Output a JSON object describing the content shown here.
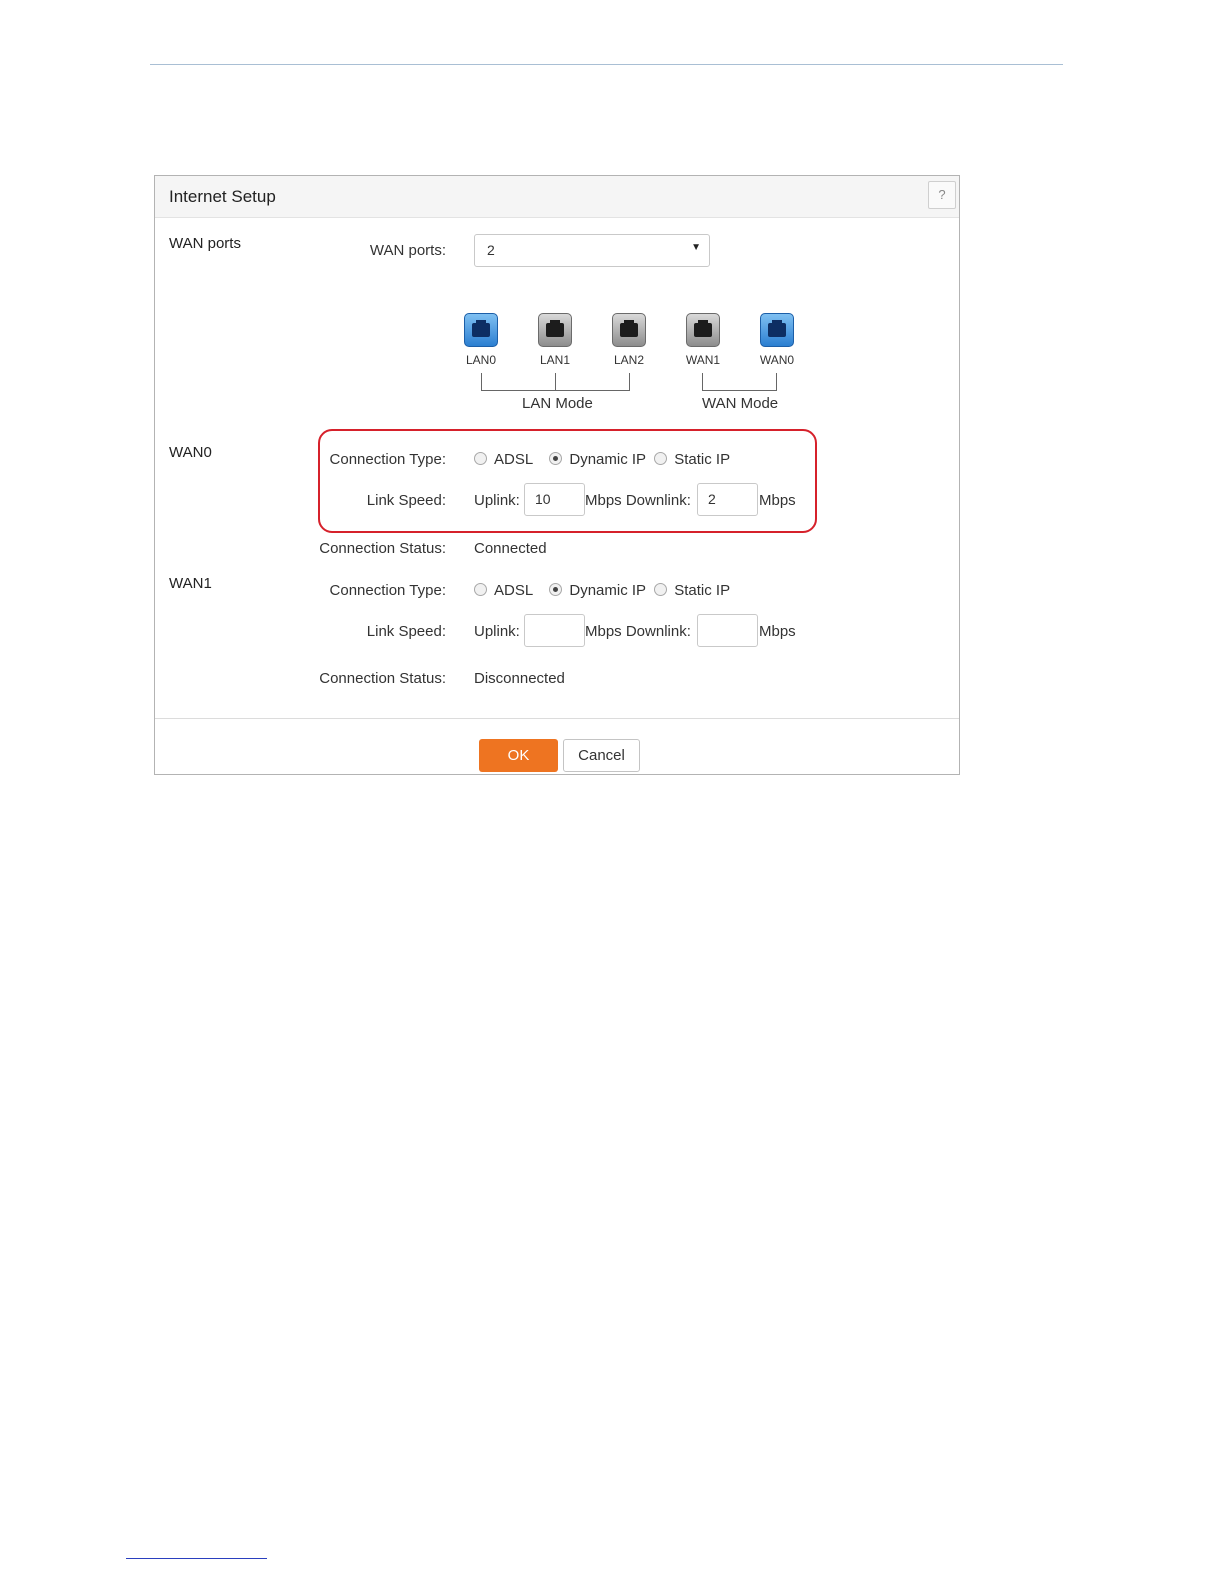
{
  "panel": {
    "title": "Internet Setup",
    "help_label": "?"
  },
  "wan_ports_section": {
    "section_label": "WAN ports",
    "field_label": "WAN ports:",
    "selected_value": "2",
    "caret": "▼"
  },
  "ports": [
    {
      "label": "LAN0",
      "color": "blue",
      "icon": "ethernet-port-icon"
    },
    {
      "label": "LAN1",
      "color": "gray",
      "icon": "ethernet-port-icon"
    },
    {
      "label": "LAN2",
      "color": "gray",
      "icon": "ethernet-port-icon"
    },
    {
      "label": "WAN1",
      "color": "gray",
      "icon": "ethernet-port-icon"
    },
    {
      "label": "WAN0",
      "color": "blue",
      "icon": "ethernet-port-icon"
    }
  ],
  "modes": {
    "lan": "LAN Mode",
    "wan": "WAN Mode"
  },
  "wan0": {
    "section_label": "WAN0",
    "connection_type_label": "Connection Type:",
    "options": [
      "ADSL",
      "Dynamic IP",
      "Static IP"
    ],
    "selected_option": "Dynamic IP",
    "link_speed_label": "Link Speed:",
    "uplink_label": "Uplink:",
    "uplink_value": "10",
    "mbps_downlink_label": "Mbps Downlink:",
    "downlink_value": "2",
    "mbps_label": "Mbps",
    "status_label": "Connection Status:",
    "status_value": "Connected"
  },
  "wan1": {
    "section_label": "WAN1",
    "connection_type_label": "Connection Type:",
    "options": [
      "ADSL",
      "Dynamic IP",
      "Static IP"
    ],
    "selected_option": "Dynamic IP",
    "link_speed_label": "Link Speed:",
    "uplink_label": "Uplink:",
    "uplink_value": "",
    "mbps_downlink_label": "Mbps Downlink:",
    "downlink_value": "",
    "mbps_label": "Mbps",
    "status_label": "Connection Status:",
    "status_value": "Disconnected"
  },
  "buttons": {
    "ok": "OK",
    "cancel": "Cancel"
  },
  "colors": {
    "accent": "#ee7421",
    "highlight": "#d6212b",
    "port_active": "#2b7fd1",
    "port_inactive": "#8d8d8d"
  }
}
